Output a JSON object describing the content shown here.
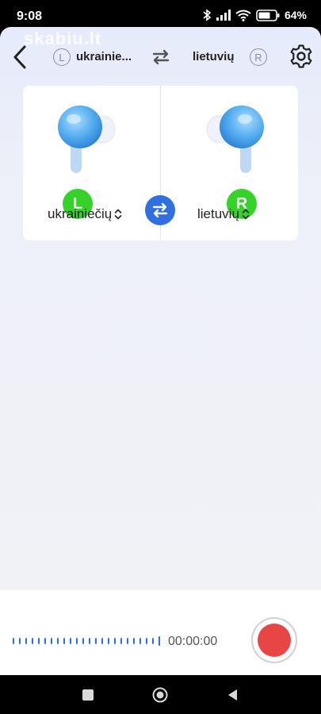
{
  "status_bar": {
    "time": "9:08",
    "battery": "64%",
    "icons": [
      "bluetooth-icon",
      "signal-icon",
      "wifi-icon",
      "battery-icon"
    ]
  },
  "watermark": "skabiu.lt",
  "header": {
    "left_badge": "L",
    "left_language": "ukrainie...",
    "right_language": "lietuvių",
    "right_badge": "R"
  },
  "card": {
    "left": {
      "side": "L",
      "language": "ukrainiečių"
    },
    "right": {
      "side": "R",
      "language": "lietuvių"
    }
  },
  "recorder": {
    "timer": "00:00:00"
  },
  "colors": {
    "accent_blue": "#2f6fe0",
    "badge_green": "#35d32a",
    "record_red": "#e84545"
  }
}
